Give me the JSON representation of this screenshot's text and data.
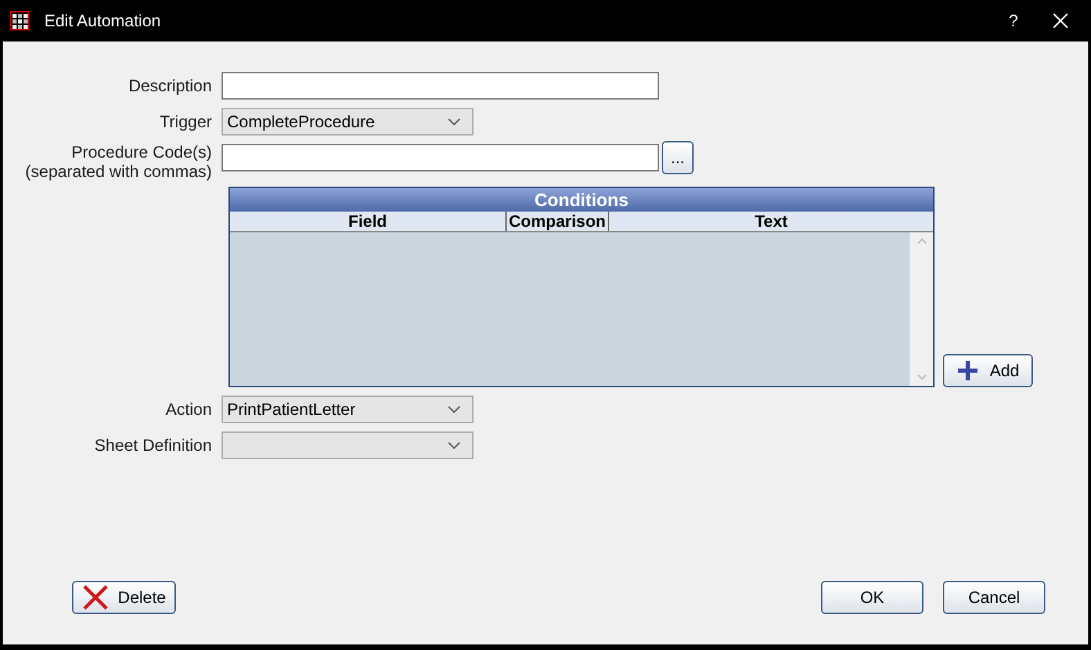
{
  "window": {
    "title": "Edit Automation",
    "help": "?"
  },
  "description": {
    "label": "Description"
  },
  "trigger": {
    "label": "Trigger",
    "value": "CompleteProcedure"
  },
  "procedure_codes": {
    "label": "Procedure Code(s)",
    "hint": "(separated with commas)",
    "browse": "..."
  },
  "conditions": {
    "title": "Conditions",
    "columns": [
      "Field",
      "Comparison",
      "Text"
    ],
    "add": "Add"
  },
  "action": {
    "label": "Action",
    "value": "PrintPatientLetter"
  },
  "sheet_definition": {
    "label": "Sheet Definition"
  },
  "buttons": {
    "delete": "Delete",
    "ok": "OK",
    "cancel": "Cancel"
  }
}
